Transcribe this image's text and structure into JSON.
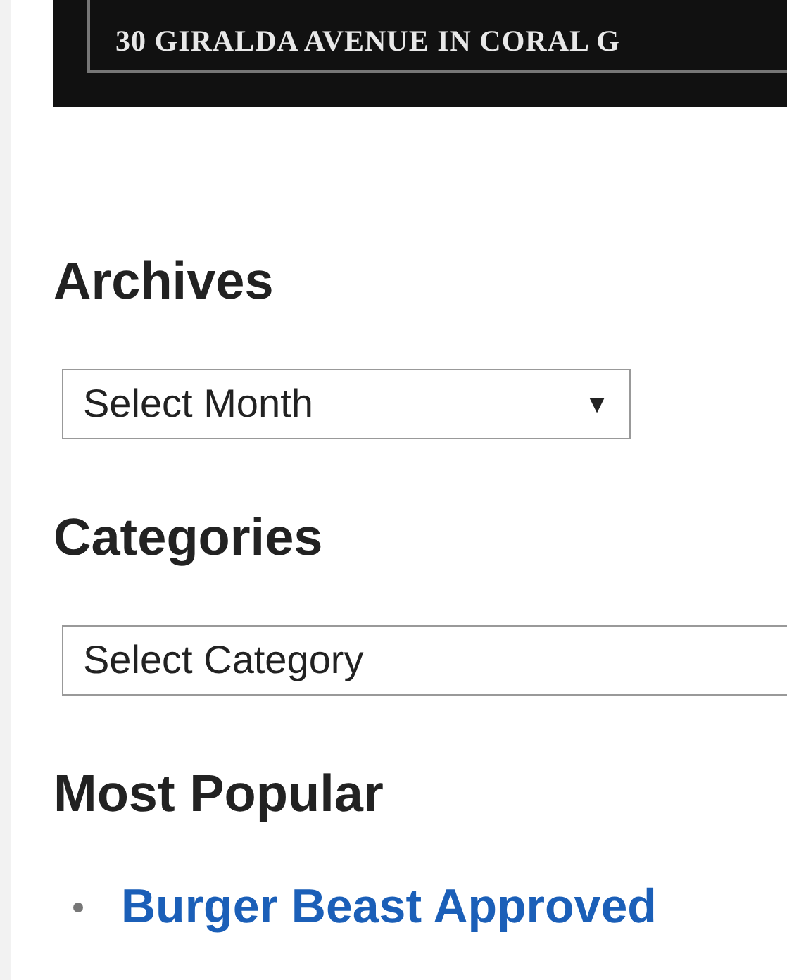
{
  "banner": {
    "text": "30 GIRALDA AVENUE IN CORAL G"
  },
  "archives": {
    "heading": "Archives",
    "select": {
      "value": "Select Month",
      "arrow": "▼"
    }
  },
  "categories": {
    "heading": "Categories",
    "select": {
      "value": "Select Category"
    }
  },
  "most_popular": {
    "heading": "Most Popular",
    "items": [
      {
        "label": "Burger Beast Approved"
      }
    ]
  }
}
